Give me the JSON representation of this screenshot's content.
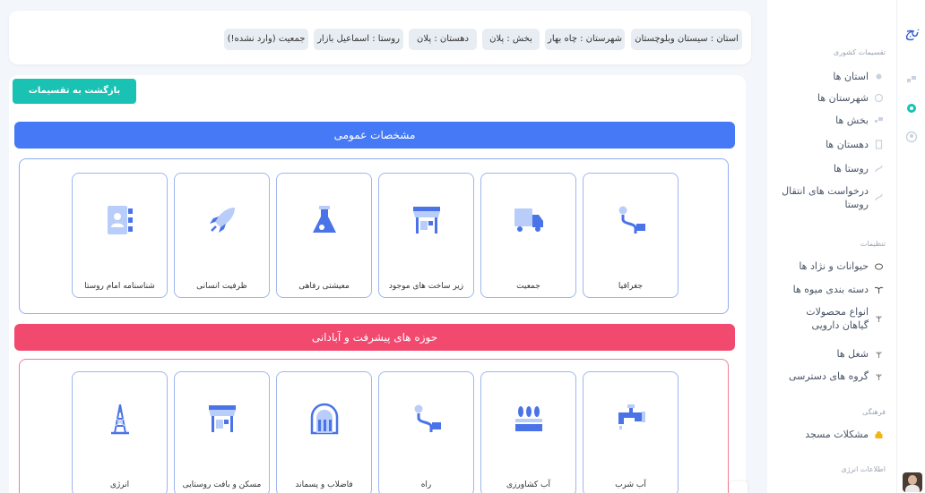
{
  "brand": {
    "logo_text": "نج"
  },
  "breadcrumb": [
    {
      "label": "استان : سیستان وبلوچستان"
    },
    {
      "label": "شهرستان : چاه بهار"
    },
    {
      "label": "بخش : پلان"
    },
    {
      "label": "دهستان : پلان"
    },
    {
      "label": "روستا : اسماعیل بازار"
    },
    {
      "label": "جمعیت (وارد نشده!)"
    }
  ],
  "back_button": {
    "label": "بازگشت به تقسیمات کشوری"
  },
  "sidebar": {
    "sections": [
      {
        "title": "تقسیمات کشوری"
      },
      {
        "title": "تنظیمات"
      },
      {
        "title": "فرهنگی"
      },
      {
        "title": "اطلاعات انرژی"
      }
    ],
    "items": [
      {
        "label": "استان ها"
      },
      {
        "label": "شهرستان ها"
      },
      {
        "label": "بخش ها"
      },
      {
        "label": "دهستان ها"
      },
      {
        "label": "روستا ها"
      },
      {
        "label": "درخواست های انتقال روستا"
      },
      {
        "label": "حیوانات و نژاد ها"
      },
      {
        "label": "دسته بندی میوه ها"
      },
      {
        "label": "انواع محصولات گیاهان دارویی"
      },
      {
        "label": "شغل ها"
      },
      {
        "label": "گروه های دسترسی"
      },
      {
        "label": "مشکلات مسجد"
      }
    ]
  },
  "sections": {
    "general": {
      "title": "مشخصات عمومی",
      "cards": [
        {
          "label": "جغرافیا",
          "icon": "road-sign-icon"
        },
        {
          "label": "جمعیت",
          "icon": "truck-icon"
        },
        {
          "label": "زیر ساخت های موجود",
          "icon": "market-stall-icon"
        },
        {
          "label": "معیشتی رفاهی",
          "icon": "flask-icon"
        },
        {
          "label": "ظرفیت انسانی",
          "icon": "rocket-icon"
        },
        {
          "label": "شناسنامه امام روستا",
          "icon": "contact-book-icon"
        }
      ]
    },
    "development": {
      "title": "حوزه های پیشرفت و آبادانی",
      "cards": [
        {
          "label": "آب شرب",
          "icon": "water-tap-icon"
        },
        {
          "label": "آب کشاورزی",
          "icon": "irrigation-icon"
        },
        {
          "label": "راه",
          "icon": "road-sign-icon"
        },
        {
          "label": "فاضلاب و پسماند",
          "icon": "sewage-icon"
        },
        {
          "label": "مسکن و بافت روستایی",
          "icon": "market-stall-icon"
        },
        {
          "label": "انرژی",
          "icon": "power-tower-icon"
        }
      ]
    }
  },
  "colors": {
    "accent_blue": "#4579f5",
    "accent_pink": "#f2496f",
    "teal_button": "#19c2b3",
    "icon_blue": "#4a73e8",
    "icon_light": "#b9cdfa"
  }
}
